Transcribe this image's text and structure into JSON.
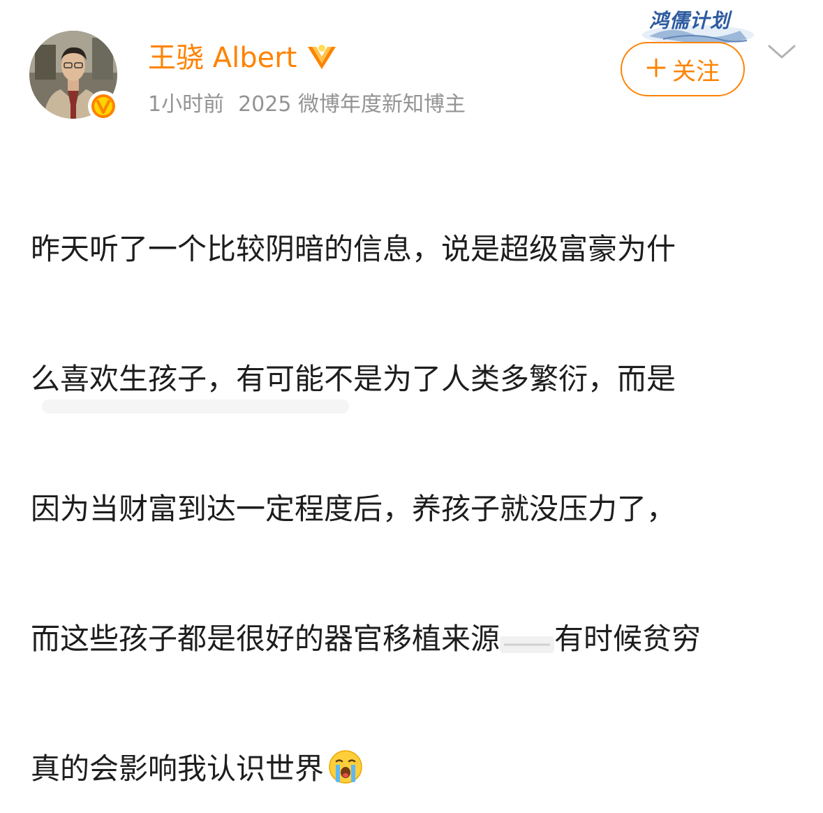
{
  "author": {
    "name": "王骁 Albert",
    "verified": true,
    "accent_color": "#ff8200"
  },
  "meta": {
    "time": "1小时前",
    "badge": "2025 微博年度新知博主"
  },
  "campaign": {
    "label": "鸿儒计划"
  },
  "follow": {
    "icon": "plus-icon",
    "label": "关注"
  },
  "more": {
    "icon": "chevron-down-icon"
  },
  "post": {
    "lines": [
      "昨天听了一个比较阴暗的信息，说是超级富豪为什",
      "么喜欢生孩子，有可能不是为了人类多繁衍，而是",
      "因为当财富到达一定程度后，养孩子就没压力了，",
      "而这些孩子都是很好的器官移植来源",
      "有时候贫穷",
      "真的会影响我认识世界"
    ],
    "emoji": "crying-face-emoji"
  }
}
